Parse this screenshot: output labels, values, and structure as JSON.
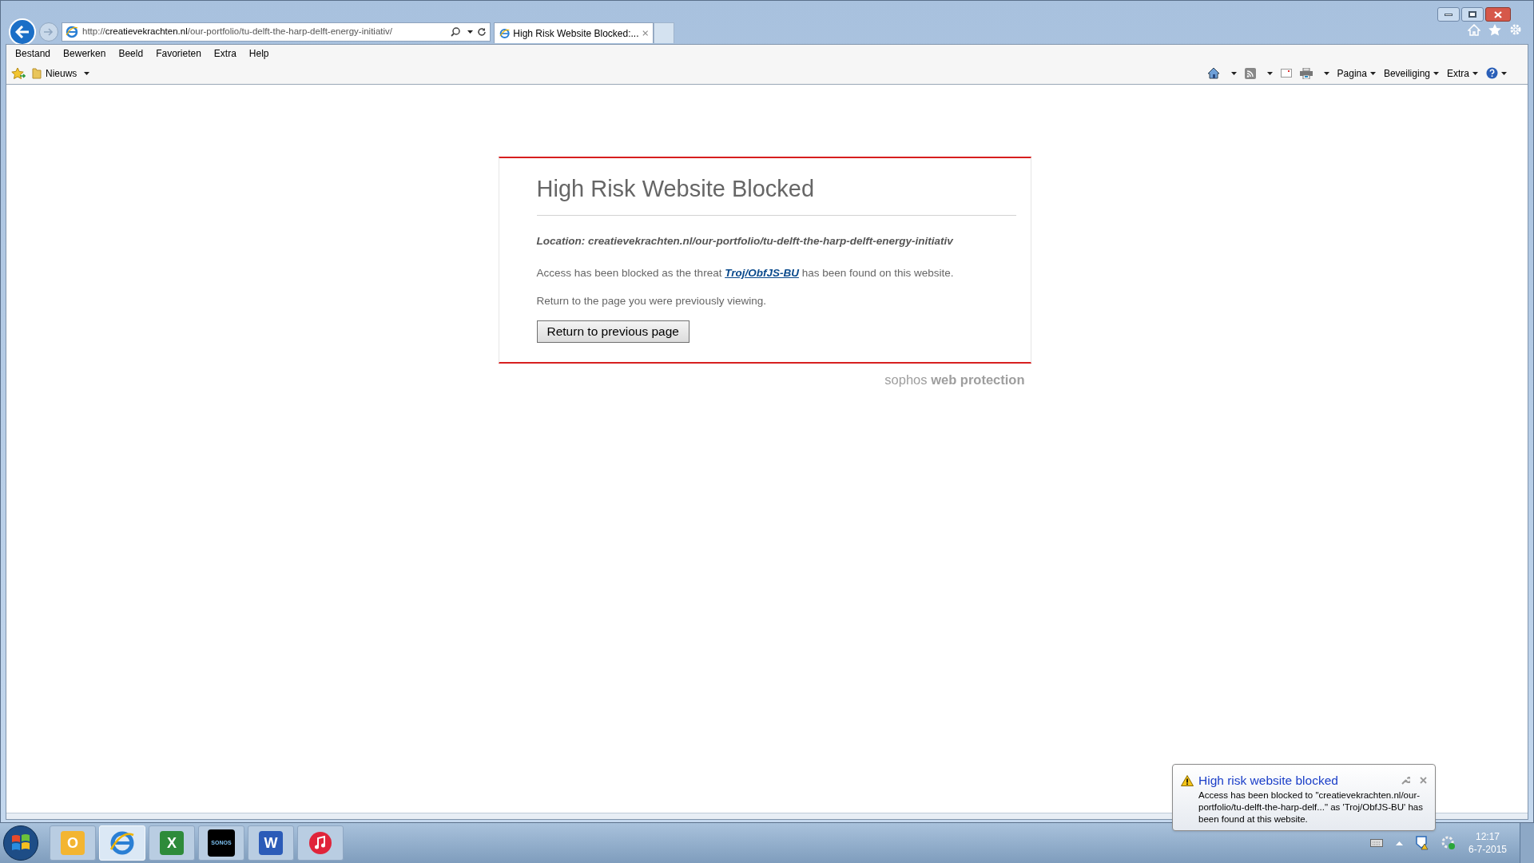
{
  "address_bar": {
    "scheme": "http://",
    "domain": "creatievekrachten.nl",
    "path": "/our-portfolio/tu-delft-the-harp-delft-energy-initiativ/"
  },
  "tabs": [
    {
      "label": "High Risk Website Blocked:...",
      "selected": true
    }
  ],
  "menu": [
    "Bestand",
    "Bewerken",
    "Beeld",
    "Favorieten",
    "Extra",
    "Help"
  ],
  "favorites_bar": {
    "folder": "Nieuws"
  },
  "command_bar": [
    "Pagina",
    "Beveiliging",
    "Extra"
  ],
  "page": {
    "title": "High Risk Website Blocked",
    "location": "Location: creatievekrachten.nl/our-portfolio/tu-delft-the-harp-delft-energy-initiativ",
    "message_before": "Access has been blocked as the threat ",
    "threat": "Troj/ObfJS-BU",
    "message_after": " has been found on this website.",
    "hint": "Return to the page you were previously viewing.",
    "button": "Return to previous page",
    "brand": "sophos",
    "product": "web protection"
  },
  "notification": {
    "title": "High risk website blocked",
    "body": "Access has been blocked to \"creatievekrachten.nl/our-portfolio/tu-delft-the-harp-delf...\" as 'Troj/ObfJS-BU' has been found at this website."
  },
  "taskbar": {
    "apps": [
      {
        "kind": "outlook",
        "glyph": "O",
        "selected": false
      },
      {
        "kind": "browser",
        "selected": true
      },
      {
        "kind": "excel",
        "glyph": "X",
        "selected": false
      },
      {
        "kind": "sonos",
        "glyph": "SONOS",
        "selected": false
      },
      {
        "kind": "word",
        "glyph": "W",
        "selected": false
      },
      {
        "kind": "music",
        "selected": false
      }
    ],
    "time": "12:17",
    "date": "6-7-2015"
  }
}
